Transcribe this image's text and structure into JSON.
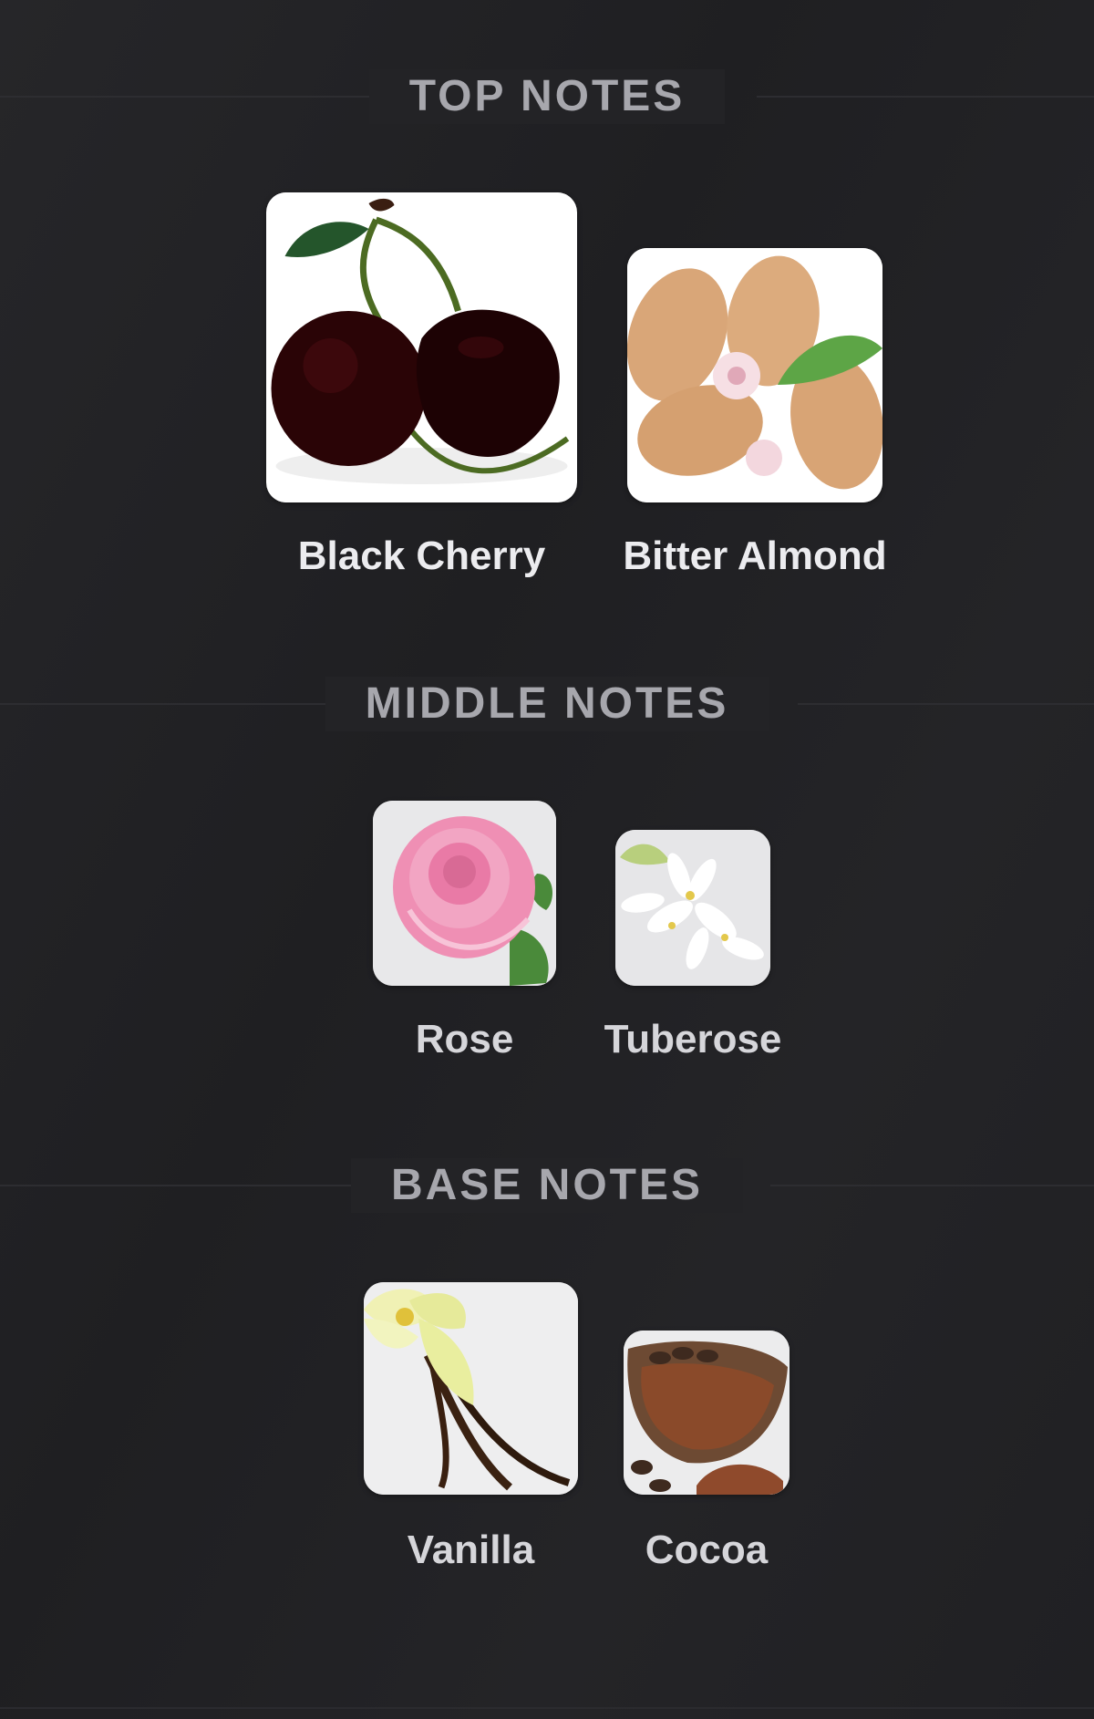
{
  "sections": [
    {
      "title": "TOP NOTES",
      "notes": [
        {
          "label": "Black Cherry",
          "icon": "black-cherry-image"
        },
        {
          "label": "Bitter Almond",
          "icon": "bitter-almond-image"
        }
      ]
    },
    {
      "title": "MIDDLE NOTES",
      "notes": [
        {
          "label": "Rose",
          "icon": "rose-image"
        },
        {
          "label": "Tuberose",
          "icon": "tuberose-image"
        }
      ]
    },
    {
      "title": "BASE NOTES",
      "notes": [
        {
          "label": "Vanilla",
          "icon": "vanilla-image"
        },
        {
          "label": "Cocoa",
          "icon": "cocoa-image"
        }
      ]
    }
  ]
}
